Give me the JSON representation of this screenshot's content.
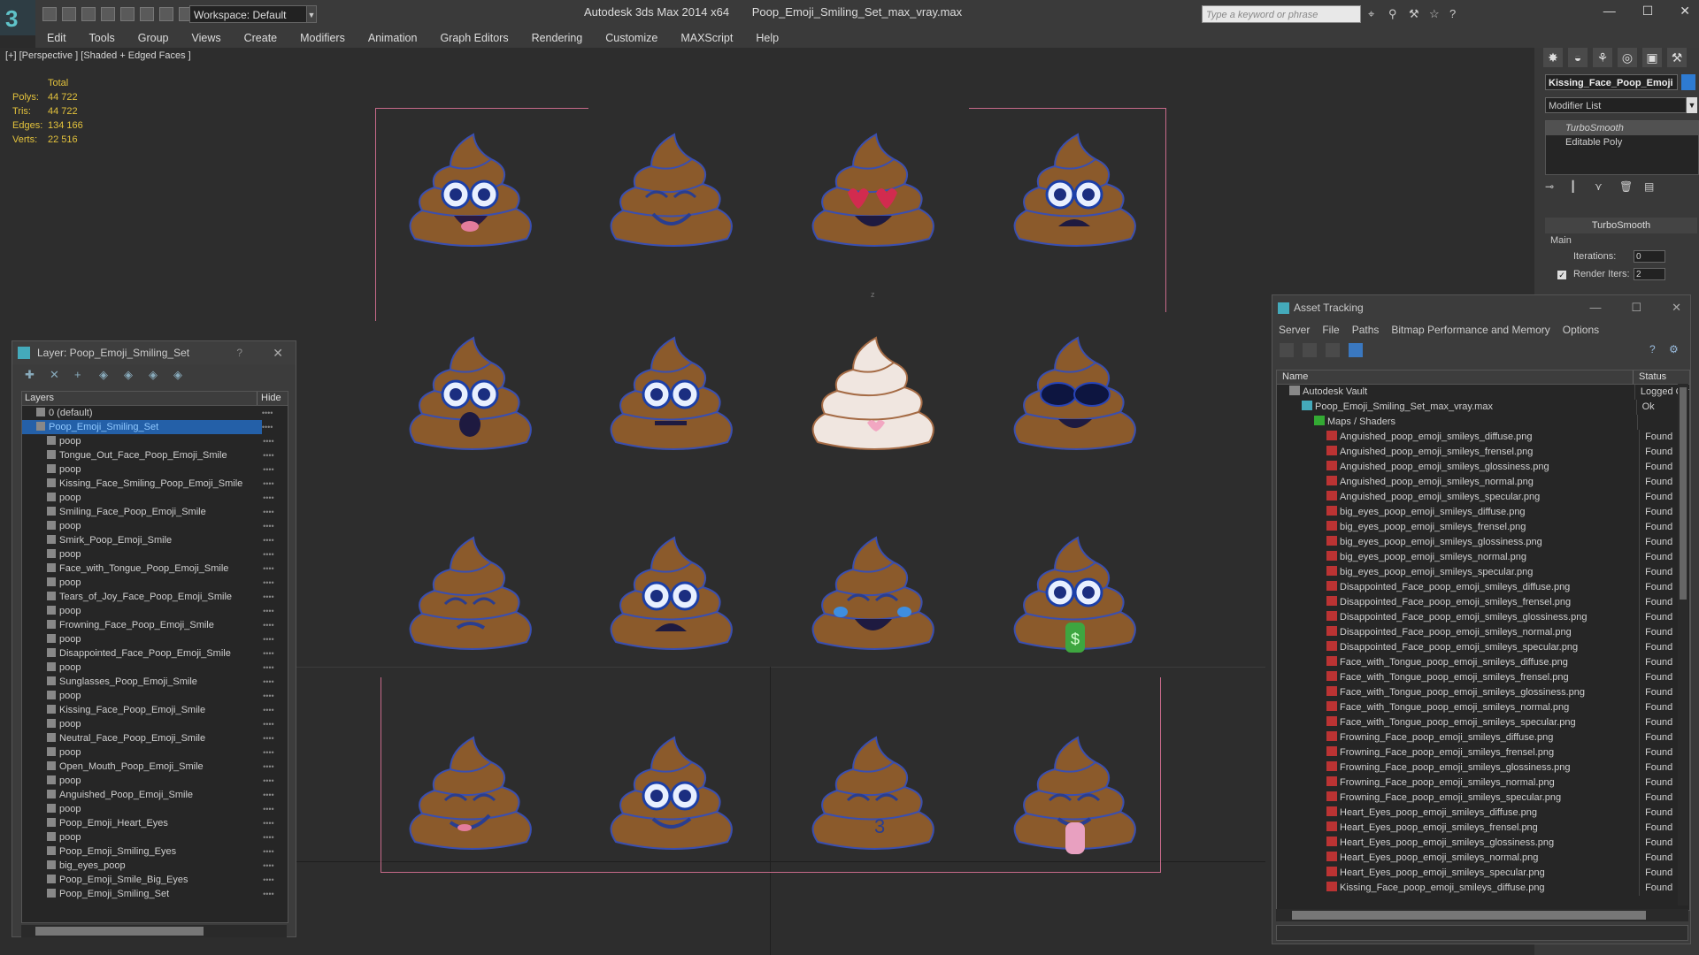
{
  "app": {
    "workspace_label": "Workspace: Default",
    "title": "Autodesk 3ds Max 2014 x64",
    "file": "Poop_Emoji_Smiling_Set_max_vray.max",
    "search_placeholder": "Type a keyword or phrase"
  },
  "menu": [
    "Edit",
    "Tools",
    "Group",
    "Views",
    "Create",
    "Modifiers",
    "Animation",
    "Graph Editors",
    "Rendering",
    "Customize",
    "MAXScript",
    "Help"
  ],
  "viewport": {
    "label": "[+] [Perspective ] [Shaded + Edged Faces ]",
    "stats": {
      "header": "Total",
      "rows": [
        {
          "k": "Polys:",
          "v": "44 722"
        },
        {
          "k": "Tris:",
          "v": "44 722"
        },
        {
          "k": "Edges:",
          "v": "134 166"
        },
        {
          "k": "Verts:",
          "v": "22 516"
        }
      ]
    },
    "axis_label": "z"
  },
  "command_panel": {
    "object_name": "Kissing_Face_Poop_Emoji",
    "object_color": "#2e7bd2",
    "modifier_list": "Modifier List",
    "stack": [
      "TurboSmooth",
      "Editable Poly"
    ],
    "rollout": "TurboSmooth",
    "group": "Main",
    "iterations_label": "Iterations:",
    "iterations": "0",
    "render_iters_label": "Render Iters:",
    "render_iters": "2"
  },
  "layer_window": {
    "title": "Layer: Poop_Emoji_Smiling_Set",
    "col_layers": "Layers",
    "col_hide": "Hide",
    "rows": [
      {
        "name": "0 (default)",
        "level": 0
      },
      {
        "name": "Poop_Emoji_Smiling_Set",
        "level": 0,
        "selected": true
      },
      {
        "name": "poop",
        "level": 1
      },
      {
        "name": "Tongue_Out_Face_Poop_Emoji_Smile",
        "level": 1
      },
      {
        "name": "poop",
        "level": 1
      },
      {
        "name": "Kissing_Face_Smiling_Poop_Emoji_Smile",
        "level": 1
      },
      {
        "name": "poop",
        "level": 1
      },
      {
        "name": "Smiling_Face_Poop_Emoji_Smile",
        "level": 1
      },
      {
        "name": "poop",
        "level": 1
      },
      {
        "name": "Smirk_Poop_Emoji_Smile",
        "level": 1
      },
      {
        "name": "poop",
        "level": 1
      },
      {
        "name": "Face_with_Tongue_Poop_Emoji_Smile",
        "level": 1
      },
      {
        "name": "poop",
        "level": 1
      },
      {
        "name": "Tears_of_Joy_Face_Poop_Emoji_Smile",
        "level": 1
      },
      {
        "name": "poop",
        "level": 1
      },
      {
        "name": "Frowning_Face_Poop_Emoji_Smile",
        "level": 1
      },
      {
        "name": "poop",
        "level": 1
      },
      {
        "name": "Disappointed_Face_Poop_Emoji_Smile",
        "level": 1
      },
      {
        "name": "poop",
        "level": 1
      },
      {
        "name": "Sunglasses_Poop_Emoji_Smile",
        "level": 1
      },
      {
        "name": "poop",
        "level": 1
      },
      {
        "name": "Kissing_Face_Poop_Emoji_Smile",
        "level": 1
      },
      {
        "name": "poop",
        "level": 1
      },
      {
        "name": "Neutral_Face_Poop_Emoji_Smile",
        "level": 1
      },
      {
        "name": "poop",
        "level": 1
      },
      {
        "name": "Open_Mouth_Poop_Emoji_Smile",
        "level": 1
      },
      {
        "name": "poop",
        "level": 1
      },
      {
        "name": "Anguished_Poop_Emoji_Smile",
        "level": 1
      },
      {
        "name": "poop",
        "level": 1
      },
      {
        "name": "Poop_Emoji_Heart_Eyes",
        "level": 1
      },
      {
        "name": "poop",
        "level": 1
      },
      {
        "name": "Poop_Emoji_Smiling_Eyes",
        "level": 1
      },
      {
        "name": "big_eyes_poop",
        "level": 1
      },
      {
        "name": "Poop_Emoji_Smile_Big_Eyes",
        "level": 1
      },
      {
        "name": "Poop_Emoji_Smiling_Set",
        "level": 1
      }
    ]
  },
  "asset_window": {
    "title": "Asset Tracking",
    "menu": [
      "Server",
      "File",
      "Paths",
      "Bitmap Performance and Memory",
      "Options"
    ],
    "col_name": "Name",
    "col_status": "Status",
    "rows": [
      {
        "name": "Autodesk Vault",
        "status": "Logged Out",
        "type": "vault",
        "level": 1
      },
      {
        "name": "Poop_Emoji_Smiling_Set_max_vray.max",
        "status": "Ok",
        "type": "max",
        "level": 2
      },
      {
        "name": "Maps / Shaders",
        "status": "",
        "type": "folder",
        "level": 3
      },
      {
        "name": "Anguished_poop_emoji_smileys_diffuse.png",
        "status": "Found",
        "type": "png",
        "level": 4
      },
      {
        "name": "Anguished_poop_emoji_smileys_frensel.png",
        "status": "Found",
        "type": "png",
        "level": 4
      },
      {
        "name": "Anguished_poop_emoji_smileys_glossiness.png",
        "status": "Found",
        "type": "png",
        "level": 4
      },
      {
        "name": "Anguished_poop_emoji_smileys_normal.png",
        "status": "Found",
        "type": "png",
        "level": 4
      },
      {
        "name": "Anguished_poop_emoji_smileys_specular.png",
        "status": "Found",
        "type": "png",
        "level": 4
      },
      {
        "name": "big_eyes_poop_emoji_smileys_diffuse.png",
        "status": "Found",
        "type": "png",
        "level": 4
      },
      {
        "name": "big_eyes_poop_emoji_smileys_frensel.png",
        "status": "Found",
        "type": "png",
        "level": 4
      },
      {
        "name": "big_eyes_poop_emoji_smileys_glossiness.png",
        "status": "Found",
        "type": "png",
        "level": 4
      },
      {
        "name": "big_eyes_poop_emoji_smileys_normal.png",
        "status": "Found",
        "type": "png",
        "level": 4
      },
      {
        "name": "big_eyes_poop_emoji_smileys_specular.png",
        "status": "Found",
        "type": "png",
        "level": 4
      },
      {
        "name": "Disappointed_Face_poop_emoji_smileys_diffuse.png",
        "status": "Found",
        "type": "png",
        "level": 4
      },
      {
        "name": "Disappointed_Face_poop_emoji_smileys_frensel.png",
        "status": "Found",
        "type": "png",
        "level": 4
      },
      {
        "name": "Disappointed_Face_poop_emoji_smileys_glossiness.png",
        "status": "Found",
        "type": "png",
        "level": 4
      },
      {
        "name": "Disappointed_Face_poop_emoji_smileys_normal.png",
        "status": "Found",
        "type": "png",
        "level": 4
      },
      {
        "name": "Disappointed_Face_poop_emoji_smileys_specular.png",
        "status": "Found",
        "type": "png",
        "level": 4
      },
      {
        "name": "Face_with_Tongue_poop_emoji_smileys_diffuse.png",
        "status": "Found",
        "type": "png",
        "level": 4
      },
      {
        "name": "Face_with_Tongue_poop_emoji_smileys_frensel.png",
        "status": "Found",
        "type": "png",
        "level": 4
      },
      {
        "name": "Face_with_Tongue_poop_emoji_smileys_glossiness.png",
        "status": "Found",
        "type": "png",
        "level": 4
      },
      {
        "name": "Face_with_Tongue_poop_emoji_smileys_normal.png",
        "status": "Found",
        "type": "png",
        "level": 4
      },
      {
        "name": "Face_with_Tongue_poop_emoji_smileys_specular.png",
        "status": "Found",
        "type": "png",
        "level": 4
      },
      {
        "name": "Frowning_Face_poop_emoji_smileys_diffuse.png",
        "status": "Found",
        "type": "png",
        "level": 4
      },
      {
        "name": "Frowning_Face_poop_emoji_smileys_frensel.png",
        "status": "Found",
        "type": "png",
        "level": 4
      },
      {
        "name": "Frowning_Face_poop_emoji_smileys_glossiness.png",
        "status": "Found",
        "type": "png",
        "level": 4
      },
      {
        "name": "Frowning_Face_poop_emoji_smileys_normal.png",
        "status": "Found",
        "type": "png",
        "level": 4
      },
      {
        "name": "Frowning_Face_poop_emoji_smileys_specular.png",
        "status": "Found",
        "type": "png",
        "level": 4
      },
      {
        "name": "Heart_Eyes_poop_emoji_smileys_diffuse.png",
        "status": "Found",
        "type": "png",
        "level": 4
      },
      {
        "name": "Heart_Eyes_poop_emoji_smileys_frensel.png",
        "status": "Found",
        "type": "png",
        "level": 4
      },
      {
        "name": "Heart_Eyes_poop_emoji_smileys_glossiness.png",
        "status": "Found",
        "type": "png",
        "level": 4
      },
      {
        "name": "Heart_Eyes_poop_emoji_smileys_normal.png",
        "status": "Found",
        "type": "png",
        "level": 4
      },
      {
        "name": "Heart_Eyes_poop_emoji_smileys_specular.png",
        "status": "Found",
        "type": "png",
        "level": 4
      },
      {
        "name": "Kissing_Face_poop_emoji_smileys_diffuse.png",
        "status": "Found",
        "type": "png",
        "level": 4
      }
    ]
  }
}
